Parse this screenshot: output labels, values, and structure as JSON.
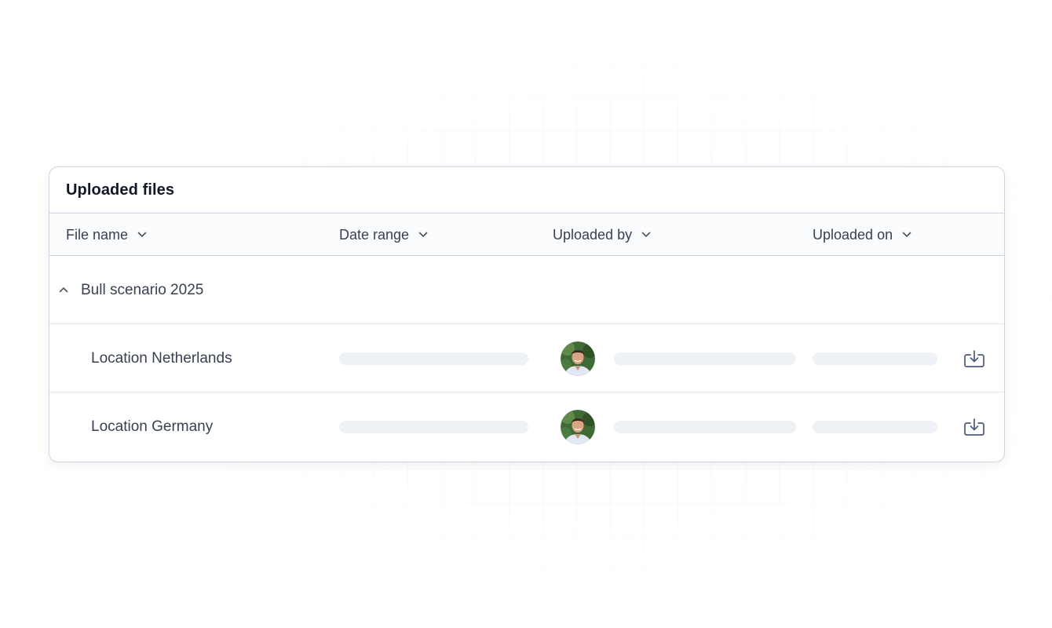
{
  "card": {
    "title": "Uploaded files"
  },
  "table": {
    "columns": [
      {
        "label": "File name",
        "icon": "chevron-down-icon"
      },
      {
        "label": "Date range",
        "icon": "chevron-down-icon"
      },
      {
        "label": "Uploaded by",
        "icon": "chevron-down-icon"
      },
      {
        "label": "Uploaded on",
        "icon": "chevron-down-icon"
      }
    ],
    "group": {
      "label": "Bull scenario 2025",
      "expanded": true,
      "toggle_icon": "chevron-up-icon"
    },
    "rows": [
      {
        "file_name": "Location Netherlands",
        "avatar": "user-avatar",
        "action_icon": "download-icon"
      },
      {
        "file_name": "Location Germany",
        "avatar": "user-avatar",
        "action_icon": "download-icon"
      }
    ]
  },
  "colors": {
    "border": "#cfd4e2",
    "header_bg": "#fafbfd",
    "skeleton": "#eef1f5",
    "icon": "#4b5a78",
    "text": "#374151"
  }
}
